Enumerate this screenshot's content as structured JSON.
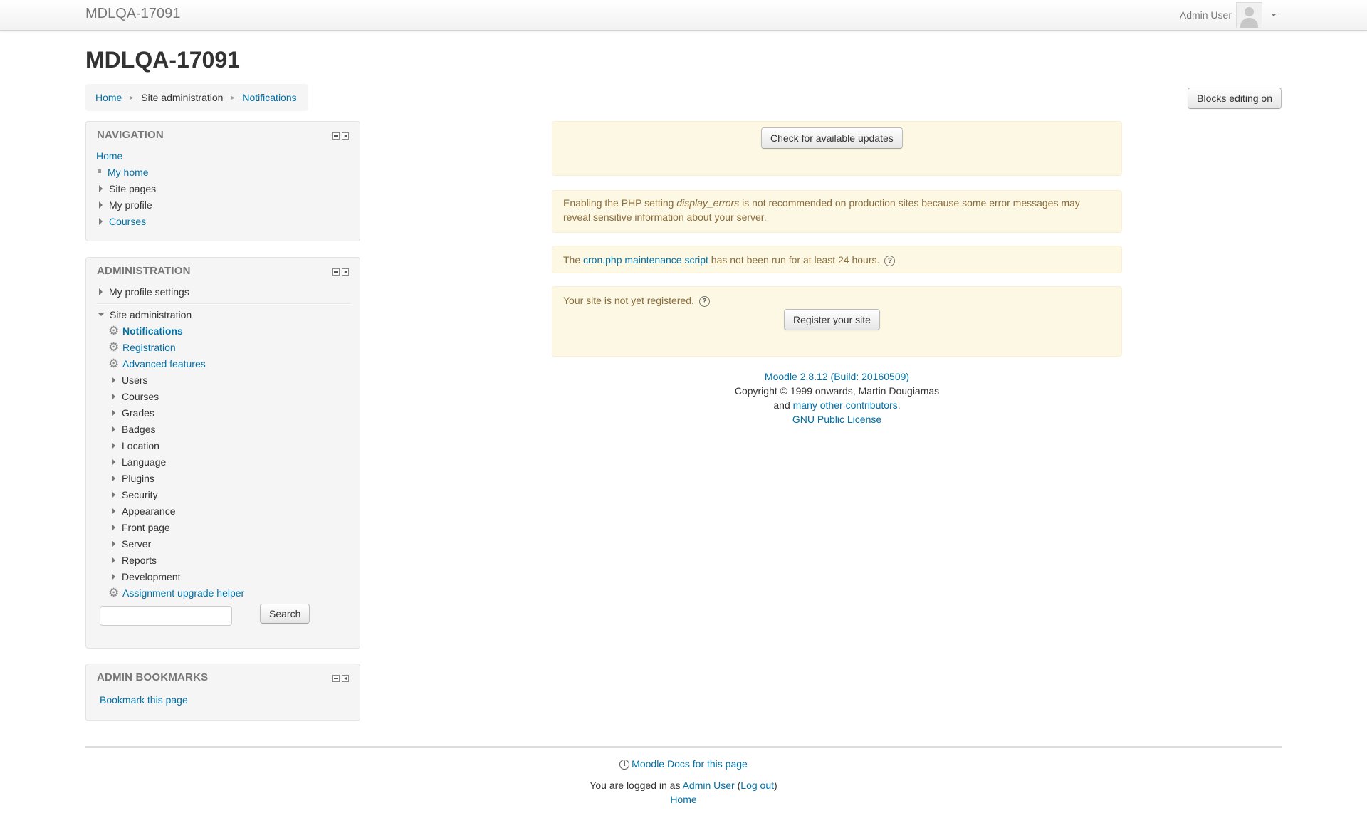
{
  "navbar": {
    "brand": "MDLQA-17091",
    "user_name": "Admin User"
  },
  "page_title": "MDLQA-17091",
  "breadcrumb": {
    "home": "Home",
    "site_admin": "Site administration",
    "current": "Notifications",
    "sep": "►"
  },
  "blocks_editing_label": "Blocks editing on",
  "navigation": {
    "title": "NAVIGATION",
    "home": "Home",
    "my_home": "My home",
    "site_pages": "Site pages",
    "my_profile": "My profile",
    "courses": "Courses"
  },
  "administration": {
    "title": "ADMINISTRATION",
    "my_profile_settings": "My profile settings",
    "site_administration": "Site administration",
    "notifications": "Notifications",
    "registration": "Registration",
    "advanced_features": "Advanced features",
    "categories": [
      "Users",
      "Courses",
      "Grades",
      "Badges",
      "Location",
      "Language",
      "Plugins",
      "Security",
      "Appearance",
      "Front page",
      "Server",
      "Reports",
      "Development"
    ],
    "assignment_upgrade_helper": "Assignment upgrade helper",
    "search_button": "Search",
    "search_value": ""
  },
  "admin_bookmarks": {
    "title": "ADMIN BOOKMARKS",
    "bookmark_link": "Bookmark this page"
  },
  "main": {
    "check_updates_button": "Check for available updates",
    "display_errors_pre": "Enabling the PHP setting ",
    "display_errors_em": "display_errors",
    "display_errors_post": " is not recommended on production sites because some error messages may",
    "display_errors_line2": "reveal sensitive information about your server.",
    "cron_pre": "The ",
    "cron_link": "cron.php maintenance script",
    "cron_post": " has not been run for at least 24 hours.",
    "not_registered": "Your site is not yet registered.",
    "register_button": "Register your site",
    "help_glyph": "?"
  },
  "version": {
    "moodle_link": "Moodle 2.8.12 (Build: 20160509)",
    "copyright": "Copyright © 1999 onwards, Martin Dougiamas",
    "and": "and ",
    "contributors_link": "many other contributors",
    "period": ".",
    "license_link": "GNU Public License"
  },
  "footer": {
    "docs_link": "Moodle Docs for this page",
    "logged_in_pre": "You are logged in as ",
    "user_link": "Admin User",
    "open_paren": " (",
    "logout_link": "Log out",
    "close_paren": ")",
    "home_link": "Home",
    "info_glyph": "i"
  },
  "colors": {
    "link": "#0070a8",
    "alert_bg": "#fcf8e3",
    "alert_text": "#8a6d3b",
    "block_bg": "#f5f5f5"
  }
}
